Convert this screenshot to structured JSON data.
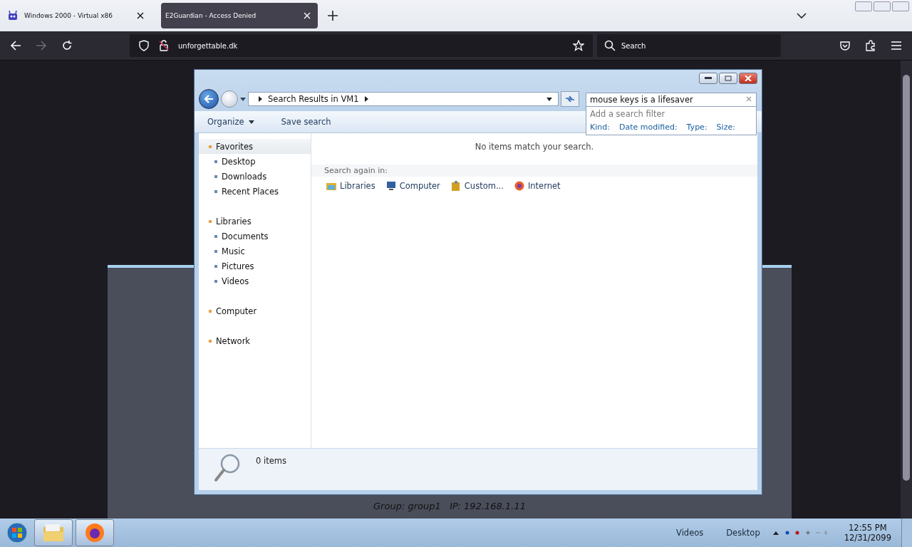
{
  "browser": {
    "tabs": [
      {
        "title": "Windows 2000 - Virtual x86",
        "selected": false
      },
      {
        "title": "E2Guardian - Access Denied",
        "selected": true
      }
    ],
    "url": "unforgettable.dk",
    "search": {
      "placeholder": "Search"
    }
  },
  "page": {
    "footer": "Group: group1   IP: 192.168.1.11"
  },
  "explorer": {
    "breadcrumb": "Search Results in VM1",
    "search": {
      "value": "mouse keys is a lifesaver"
    },
    "filter_hint": "Add a search filter",
    "filters": [
      "Kind:",
      "Date modified:",
      "Type:",
      "Size:"
    ],
    "toolbar": [
      {
        "label": "Organize",
        "dropdown": true
      },
      {
        "label": "Save search",
        "dropdown": false
      }
    ],
    "nav": [
      {
        "label": "Favorites",
        "selected": true,
        "children": [
          {
            "label": "Desktop",
            "selected": false
          },
          {
            "label": "Downloads",
            "selected": false
          },
          {
            "label": "Recent Places",
            "selected": false
          }
        ]
      },
      {
        "label": "Libraries",
        "selected": false,
        "children": [
          {
            "label": "Documents",
            "selected": false
          },
          {
            "label": "Music",
            "selected": false
          },
          {
            "label": "Pictures",
            "selected": false
          },
          {
            "label": "Videos",
            "selected": false
          }
        ]
      },
      {
        "label": "Computer",
        "selected": false
      },
      {
        "label": "Network",
        "selected": false
      }
    ],
    "message": "No items match your search.",
    "search_again": "Search again in:",
    "locations": [
      {
        "kind": "libraries",
        "label": "Libraries"
      },
      {
        "kind": "computer",
        "label": "Computer"
      },
      {
        "kind": "custom",
        "label": "Custom..."
      },
      {
        "kind": "internet",
        "label": "Internet"
      }
    ],
    "status": "0 items"
  },
  "taskbar": {
    "toolbars": [
      "Videos",
      "Desktop"
    ],
    "time": "12:55 PM",
    "date": "12/31/2099"
  }
}
